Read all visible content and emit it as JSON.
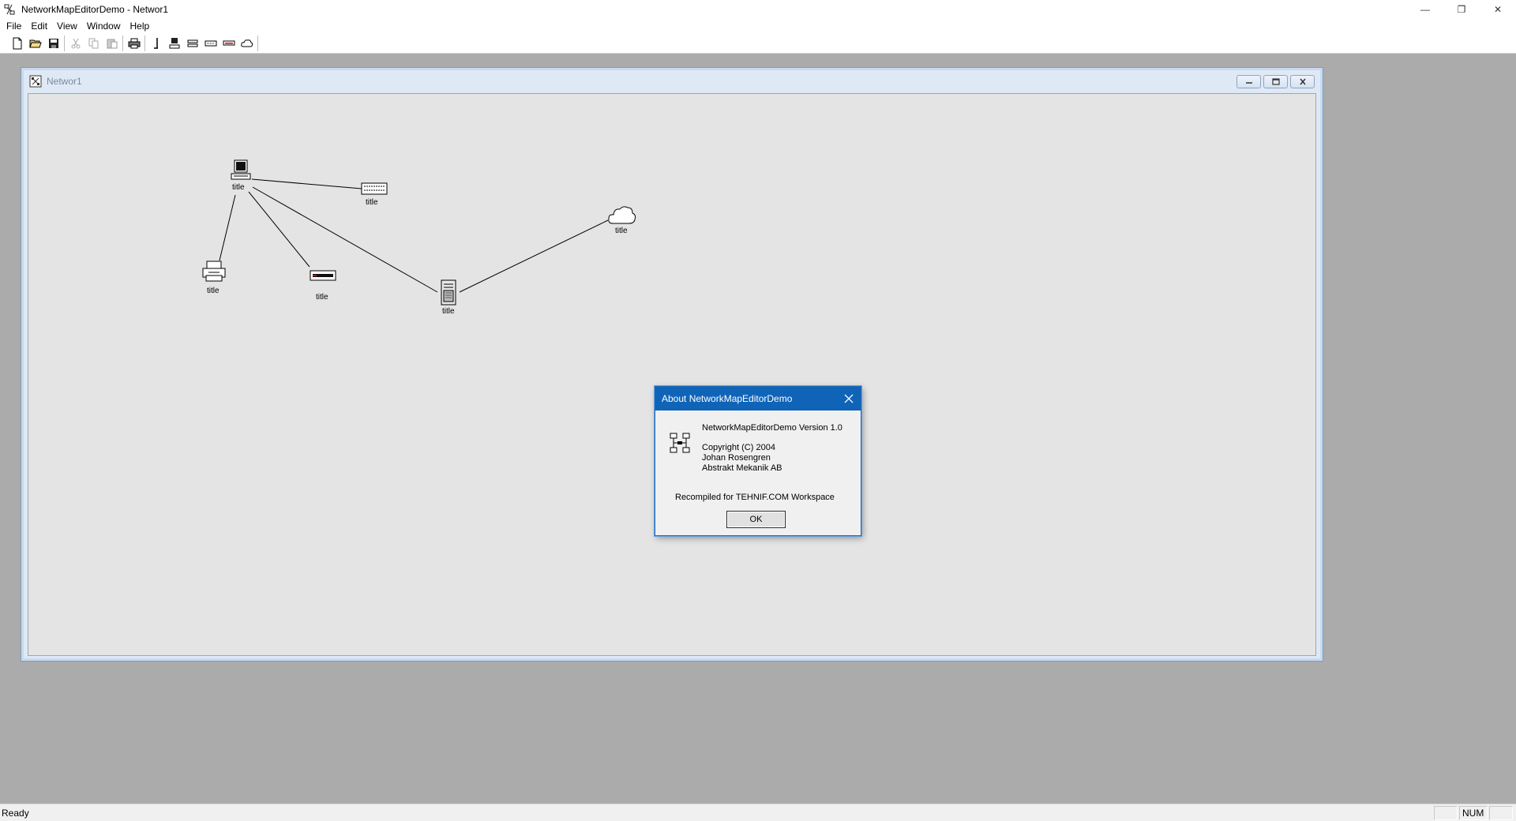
{
  "app": {
    "title": "NetworkMapEditorDemo - Networ1"
  },
  "window_controls": {
    "minimize": "—",
    "restore": "❐",
    "close": "✕"
  },
  "menu": {
    "items": [
      {
        "label": "File"
      },
      {
        "label": "Edit"
      },
      {
        "label": "View"
      },
      {
        "label": "Window"
      },
      {
        "label": "Help"
      }
    ]
  },
  "toolbar": {
    "buttons": [
      {
        "icon": "new-file-icon"
      },
      {
        "icon": "open-folder-icon"
      },
      {
        "icon": "save-icon"
      },
      {
        "icon": "cut-icon"
      },
      {
        "icon": "copy-icon"
      },
      {
        "icon": "paste-icon"
      },
      {
        "icon": "print-icon"
      },
      {
        "icon": "link-tool-icon"
      },
      {
        "icon": "computer-tool-icon"
      },
      {
        "icon": "router-tool-icon"
      },
      {
        "icon": "hub-tool-icon"
      },
      {
        "icon": "switch-tool-icon"
      },
      {
        "icon": "cloud-tool-icon"
      }
    ]
  },
  "child_window": {
    "title": "Networ1"
  },
  "network": {
    "nodes": [
      {
        "id": "computer",
        "type": "computer",
        "label": "title"
      },
      {
        "id": "hub",
        "type": "hub",
        "label": "title"
      },
      {
        "id": "cloud",
        "type": "cloud",
        "label": "title"
      },
      {
        "id": "printer",
        "type": "printer",
        "label": "title"
      },
      {
        "id": "switch",
        "type": "switch",
        "label": "title"
      },
      {
        "id": "server",
        "type": "server",
        "label": "title"
      }
    ],
    "links": [
      [
        "computer",
        "hub"
      ],
      [
        "computer",
        "printer"
      ],
      [
        "computer",
        "switch"
      ],
      [
        "computer",
        "server"
      ],
      [
        "server",
        "cloud"
      ]
    ]
  },
  "dialog": {
    "title": "About NetworkMapEditorDemo",
    "version": "NetworkMapEditorDemo Version 1.0",
    "copyright": "Copyright (C) 2004",
    "author": "Johan Rosengren",
    "company": "Abstrakt Mekanik AB",
    "recompiled": "Recompiled for TEHNIF.COM Workspace",
    "ok_label": "OK",
    "accent": "#0f64b8"
  },
  "status": {
    "text": "Ready",
    "panes": [
      "",
      "NUM",
      ""
    ]
  }
}
